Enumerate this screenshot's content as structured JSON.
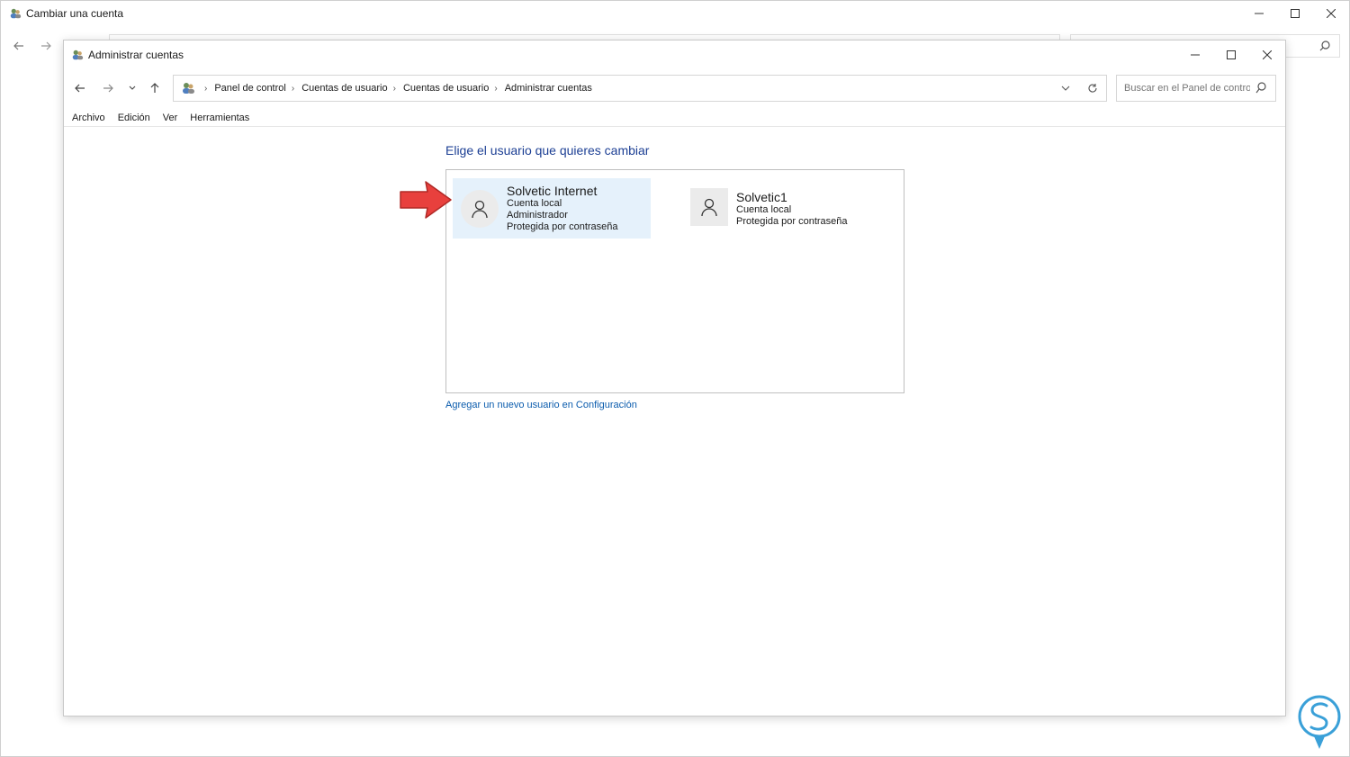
{
  "back_window": {
    "title": "Cambiar una cuenta"
  },
  "front_window": {
    "title": "Administrar cuentas",
    "breadcrumbs": [
      "Panel de control",
      "Cuentas de usuario",
      "Cuentas de usuario",
      "Administrar cuentas"
    ],
    "search_placeholder": "Buscar en el Panel de control",
    "menu": [
      "Archivo",
      "Edición",
      "Ver",
      "Herramientas"
    ],
    "heading": "Elige el usuario que quieres cambiar",
    "accounts": [
      {
        "name": "Solvetic Internet",
        "lines": [
          "Cuenta local",
          "Administrador",
          "Protegida por contraseña"
        ],
        "selected": true
      },
      {
        "name": "Solvetic1",
        "lines": [
          "Cuenta local",
          "Protegida por contraseña"
        ],
        "selected": false
      }
    ],
    "add_user_link": "Agregar un nuevo usuario en Configuración"
  },
  "colors": {
    "heading": "#1c3f94",
    "link": "#0b5cad",
    "selected_bg": "#e5f1fb",
    "arrow": "#e8403d"
  },
  "icons": {
    "app_icon": "users-icon",
    "back": "arrow-left-icon",
    "forward": "arrow-right-icon",
    "recent": "chevron-down-icon",
    "up": "arrow-up-icon",
    "refresh": "refresh-icon",
    "search": "search-icon",
    "avatar": "user-icon",
    "pointer": "red-arrow-icon"
  }
}
